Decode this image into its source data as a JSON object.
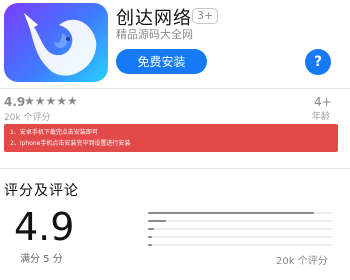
{
  "app": {
    "name": "创达网络",
    "age_badge": "3+",
    "subtitle": "精品源码大全网",
    "install_label": "免费安装",
    "help_label": "?"
  },
  "summary": {
    "rating": "4.9",
    "stars": "★★★★★",
    "rating_count": "20k 个评分",
    "age_value": "4+",
    "age_label": "年龄"
  },
  "notice": {
    "lines": [
      "1、安卓手机下载完点击安装即可",
      "2、Iphone手机点击安装完毕到设置进行安装"
    ],
    "color": "#e24a4a"
  },
  "ratings_section": {
    "title": "评分及评论",
    "big_rating": "4.9",
    "out_of": "满分 5 分",
    "count": "20k 个评分",
    "distribution": [
      {
        "stars": 5,
        "fraction": 0.9
      },
      {
        "stars": 4,
        "fraction": 0.1
      },
      {
        "stars": 3,
        "fraction": 0.03
      },
      {
        "stars": 2,
        "fraction": 0.02
      },
      {
        "stars": 1,
        "fraction": 0.02
      }
    ]
  },
  "colors": {
    "accent": "#1679f5",
    "notice": "#e24a4a"
  }
}
